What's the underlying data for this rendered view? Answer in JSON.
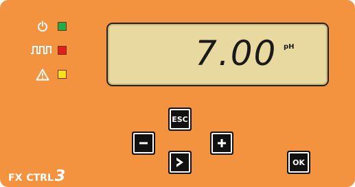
{
  "indicators": [
    {
      "icon": "power-icon",
      "color": "#1fae4b"
    },
    {
      "icon": "pulse-icon",
      "color": "#e02020"
    },
    {
      "icon": "warning-icon",
      "color": "#f6e21a"
    }
  ],
  "display": {
    "value": "7.00",
    "unit": "pH"
  },
  "keys": {
    "esc": "ESC",
    "minus": "minus-icon",
    "plus": "plus-icon",
    "enter": "chevron-right-icon",
    "ok": "OK"
  },
  "brand": {
    "a": "FX",
    "b": "CTRL",
    "c": "3"
  }
}
